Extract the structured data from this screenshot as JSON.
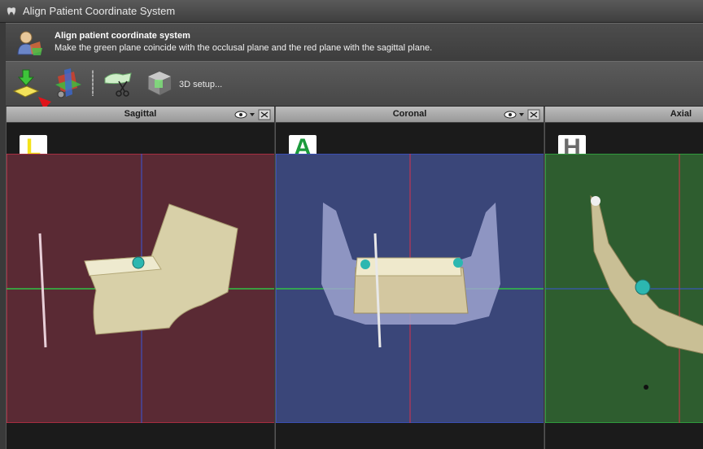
{
  "window": {
    "title": "Align Patient Coordinate System"
  },
  "header": {
    "title": "Align patient coordinate system",
    "subtitle": "Make the green plane coincide with the occlusal plane and the red plane with the sagittal plane."
  },
  "toolbar": {
    "setup_label": "3D setup...",
    "icons": [
      "align-down-icon",
      "rotate-planes-icon",
      "scissors-cut-icon",
      "cube-3d-icon"
    ]
  },
  "viewports": [
    {
      "title": "Sagittal",
      "letter": "L",
      "letter_color": "#f4e21a",
      "plane_color": "#5a2a34"
    },
    {
      "title": "Coronal",
      "letter": "A",
      "letter_color": "#1b9a3c",
      "plane_color": "#3a4679"
    },
    {
      "title": "Axial",
      "letter": "H",
      "letter_color": "#6b6b6b",
      "plane_color": "#2e5d2f"
    }
  ],
  "colors": {
    "red_line": "#d9304a",
    "green_line": "#31c245",
    "blue_line": "#3c55d8"
  }
}
